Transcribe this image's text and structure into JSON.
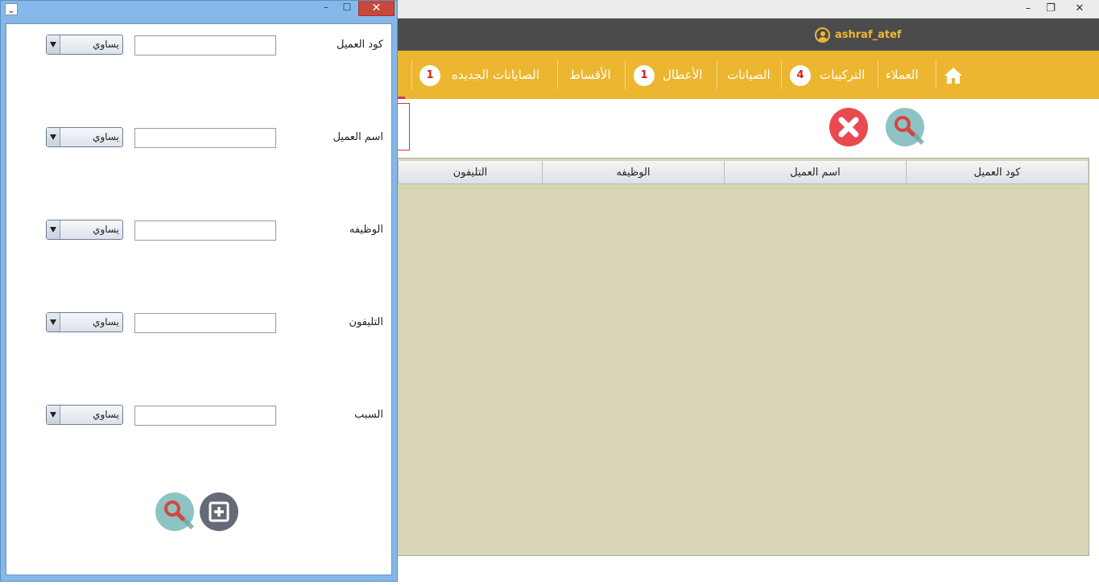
{
  "main_window": {
    "controls": {
      "minimize": "–",
      "restore": "❐",
      "close": "✕"
    },
    "username": "ashraf_atef",
    "nav": {
      "home_icon": "home-icon",
      "items": [
        {
          "label": "العملاء"
        },
        {
          "label": "التركيبات",
          "badge": "4"
        },
        {
          "label": "الصيانات"
        },
        {
          "label": "الأعطال",
          "badge": "1"
        },
        {
          "label": "الأقساط"
        },
        {
          "label": "الصايانات الجديده",
          "badge": "1"
        }
      ]
    },
    "table": {
      "columns": [
        "كود العميل",
        "اسم العميل",
        "الوظيفه",
        "التليفون"
      ]
    },
    "colors": {
      "nav": "#ecb630",
      "user_bar": "#4b4b4b",
      "table_bg": "#d8d6b7"
    }
  },
  "dialog": {
    "controls": {
      "minimize": "–",
      "maximize": "☐",
      "close": "✕"
    },
    "fields": [
      {
        "label": "كود العميل",
        "value": "",
        "operator": "يساوي"
      },
      {
        "label": "اسم العميل",
        "value": "",
        "operator": "يساوي"
      },
      {
        "label": "الوظيفه",
        "value": "",
        "operator": "يساوي"
      },
      {
        "label": "التليفون",
        "value": "",
        "operator": "يساوي"
      },
      {
        "label": "السبب",
        "value": "",
        "operator": "يساوي"
      }
    ],
    "buttons": {
      "search_icon": "search-icon",
      "add_icon": "add-icon"
    },
    "colors": {
      "frame": "#85b7e8",
      "close": "#c7493e"
    }
  }
}
